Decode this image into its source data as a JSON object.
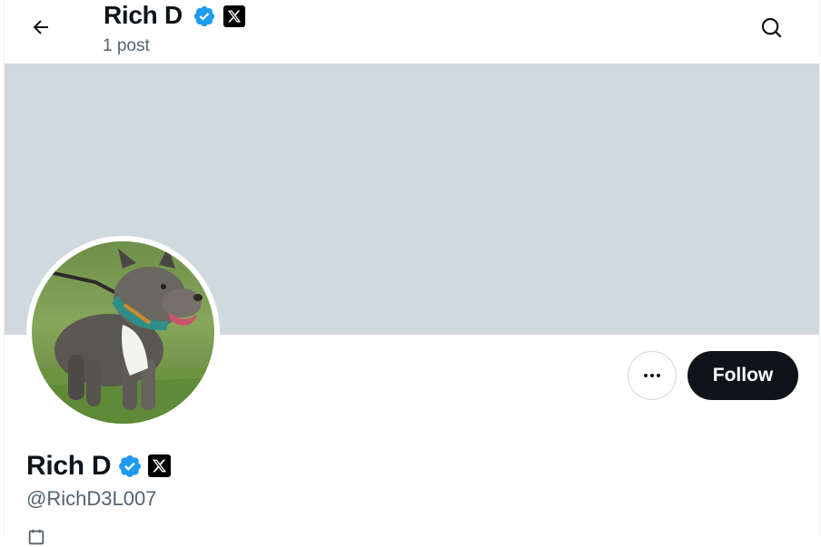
{
  "header": {
    "name": "Rich D",
    "posts_count": "1 post",
    "back_icon": "arrow-left-icon",
    "search_icon": "search-icon"
  },
  "profile": {
    "name": "Rich D",
    "handle": "@RichD3L007",
    "verified_icon": "verified-badge-icon",
    "affiliate_icon": "x-logo-badge-icon",
    "avatar_subject": "dog-photo",
    "joined_text": ""
  },
  "actions": {
    "more_icon": "more-options-icon",
    "follow_label": "Follow"
  },
  "colors": {
    "banner": "#cfd9de",
    "verified": "#1d9bf0",
    "text_primary": "#0f1419",
    "text_secondary": "#536471",
    "follow_bg": "#0f1419"
  }
}
